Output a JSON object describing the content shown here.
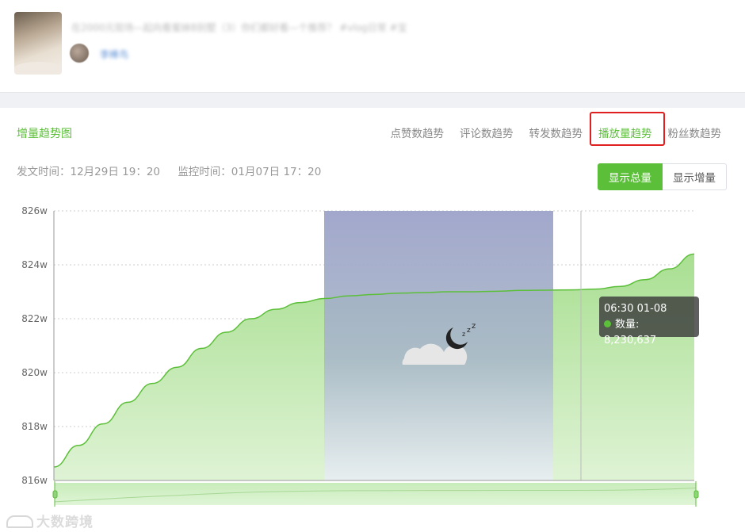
{
  "post": {
    "title": "在2000元现场—起向看蜜妹B别墅（3）你们都好看—个推荐？ #vlog日常 #宝",
    "author": "李棒鸟"
  },
  "section_title": "增量趋势图",
  "tabs": [
    {
      "label": "点赞数趋势",
      "active": false
    },
    {
      "label": "评论数趋势",
      "active": false
    },
    {
      "label": "转发数趋势",
      "active": false
    },
    {
      "label": "播放量趋势",
      "active": true
    },
    {
      "label": "粉丝数趋势",
      "active": false
    }
  ],
  "meta": {
    "publish_time": "发文时间：12月29日 19：20",
    "monitor_time": "监控时间：01月07日 17：20"
  },
  "toggle": {
    "total_label": "显示总量",
    "increment_label": "显示增量"
  },
  "tooltip": {
    "time": "06:30 01-08",
    "label": "数量: 8,230,637"
  },
  "watermark": "大数跨境",
  "colors": {
    "accent": "#5cbf3a",
    "area_fill": "#b6e6a2",
    "line": "#5cbf3a",
    "night_overlay": "#9aa3cc",
    "highlight_box": "#e02020"
  },
  "chart_data": {
    "type": "area",
    "ylabel": "",
    "xlabel": "",
    "y_ticks": [
      "816w",
      "818w",
      "820w",
      "822w",
      "824w",
      "826w"
    ],
    "ylim": [
      816,
      826
    ],
    "y_unit": "w",
    "grid": true,
    "night_period_marker": "sleep-moon",
    "series": [
      {
        "values": [
          816.5,
          817.3,
          818.1,
          818.9,
          819.6,
          820.2,
          820.9,
          821.5,
          822.0,
          822.35,
          822.6,
          822.75,
          822.85,
          822.9,
          822.95,
          822.97,
          823.0,
          823.0,
          823.02,
          823.05,
          823.06,
          823.07,
          823.1,
          823.2,
          823.45,
          823.85,
          824.4
        ]
      }
    ],
    "hover_point": {
      "time": "06:30 01-08",
      "value": 823.06
    }
  }
}
